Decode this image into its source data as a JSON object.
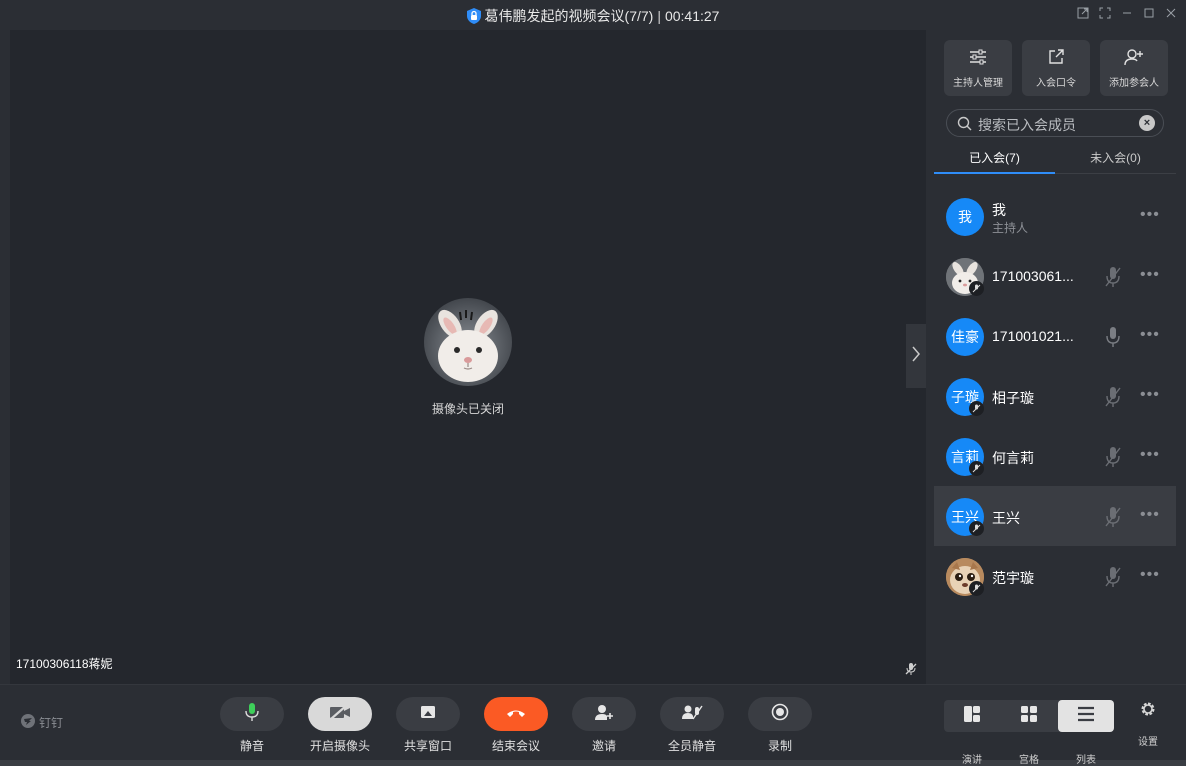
{
  "window": {
    "title": "葛伟鹏发起的视频会议(7/7)",
    "timer": "00:41:27"
  },
  "video": {
    "camera_off_text": "摄像头已关闭",
    "speaker_name": "17100306118蒋妮"
  },
  "sidebar": {
    "actions": [
      {
        "label": "主持人管理",
        "icon": "sliders-icon"
      },
      {
        "label": "入会口令",
        "icon": "share-link-icon"
      },
      {
        "label": "添加参会人",
        "icon": "add-person-icon"
      }
    ],
    "search_placeholder": "搜索已入会成员",
    "tabs": [
      {
        "label": "已入会(7)",
        "active": true
      },
      {
        "label": "未入会(0)",
        "active": false
      }
    ],
    "members": [
      {
        "avatar_text": "我",
        "name": "我",
        "role": "主持人",
        "avatar_type": "text",
        "mic": "none"
      },
      {
        "avatar_text": "",
        "name": "171003061...",
        "role": "",
        "avatar_type": "rabbit",
        "mic": "muted"
      },
      {
        "avatar_text": "佳豪",
        "name": "171001021...",
        "role": "",
        "avatar_type": "text",
        "mic": "on"
      },
      {
        "avatar_text": "子璇",
        "name": "相子璇",
        "role": "",
        "avatar_type": "text",
        "mic": "muted"
      },
      {
        "avatar_text": "言莉",
        "name": "何言莉",
        "role": "",
        "avatar_type": "text",
        "mic": "muted"
      },
      {
        "avatar_text": "王兴",
        "name": "王兴",
        "role": "",
        "avatar_type": "text",
        "mic": "muted"
      },
      {
        "avatar_text": "",
        "name": "范宇璇",
        "role": "",
        "avatar_type": "cat",
        "mic": "muted"
      }
    ]
  },
  "toolbar": {
    "logo_text": "钉钉",
    "buttons": [
      {
        "label": "静音",
        "icon": "microphone-icon"
      },
      {
        "label": "开启摄像头",
        "icon": "camera-off-icon"
      },
      {
        "label": "共享窗口",
        "icon": "screen-share-icon"
      },
      {
        "label": "结束会议",
        "icon": "hang-up-icon"
      },
      {
        "label": "邀请",
        "icon": "invite-icon"
      },
      {
        "label": "全员静音",
        "icon": "mute-all-icon"
      },
      {
        "label": "录制",
        "icon": "record-icon"
      }
    ],
    "layouts": [
      {
        "label": "演讲",
        "active": false
      },
      {
        "label": "宫格",
        "active": false
      },
      {
        "label": "列表",
        "active": true
      }
    ],
    "settings_label": "设置"
  },
  "colors": {
    "accent": "#2f8df8",
    "end_call": "#fb5a24",
    "mic_green": "#3ecf5a",
    "avatar_blue": "#1689f7"
  }
}
